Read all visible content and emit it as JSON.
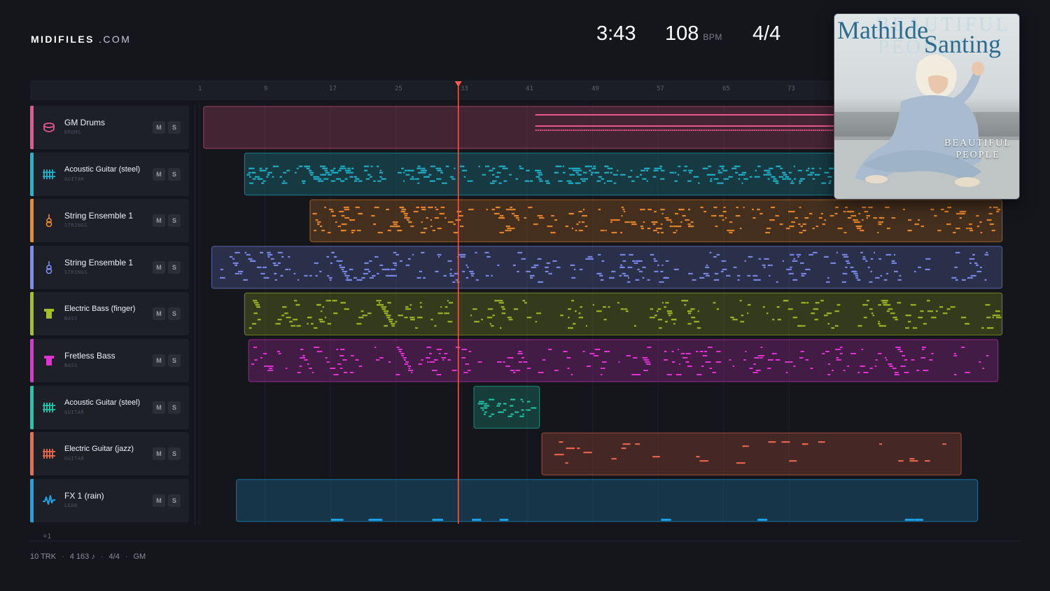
{
  "brand": {
    "name": "MIDIFILES",
    "suffix": ".COM"
  },
  "transport": {
    "time": "3:43",
    "tempo": "108",
    "tempo_unit": "BPM",
    "meter": "4/4"
  },
  "album": {
    "artist_first": "Mathilde",
    "artist_last": "Santing",
    "ghost_line1": "BEAUTIFUL",
    "ghost_line2": "PEOPLE",
    "title_line1": "BEAUTIFUL",
    "title_line2": "PEOPLE"
  },
  "ruler": {
    "bars": [
      "1",
      "9",
      "17",
      "25",
      "33",
      "41",
      "49",
      "57",
      "65",
      "73"
    ],
    "playhead_bar": 32.6
  },
  "mute_label": "M",
  "solo_label": "S",
  "tracks": [
    {
      "name": "GM Drums",
      "type": "DRUMS",
      "color": "#e8558a",
      "icon": "drum-icon",
      "clip_bars": [
        1.5,
        93
      ],
      "pattern": "drums"
    },
    {
      "name": "Acoustic Guitar (steel)",
      "type": "GUITAR",
      "color": "#1fb6cf",
      "icon": "guitar-fret-icon",
      "clip_bars": [
        6.5,
        93
      ],
      "pattern": "dense"
    },
    {
      "name": "String Ensemble 1",
      "type": "STRINGS",
      "color": "#ef8a2a",
      "icon": "violin-icon",
      "clip_bars": [
        14.5,
        99
      ],
      "pattern": "blocks"
    },
    {
      "name": "String Ensemble 1",
      "type": "STRINGS",
      "color": "#7d8cf2",
      "icon": "violin-icon",
      "clip_bars": [
        2.5,
        99
      ],
      "pattern": "runs"
    },
    {
      "name": "Electric Bass (finger)",
      "type": "BASS",
      "color": "#a3c123",
      "icon": "bass-icon",
      "clip_bars": [
        6.5,
        99
      ],
      "pattern": "sparse"
    },
    {
      "name": "Fretless Bass",
      "type": "BASS",
      "color": "#e331d6",
      "icon": "bass-icon",
      "clip_bars": [
        7,
        98.5
      ],
      "pattern": "sparse"
    },
    {
      "name": "Acoustic Guitar (steel)",
      "type": "GUITAR",
      "color": "#1ec9ac",
      "icon": "guitar-fret-icon",
      "clip_bars": [
        34.5,
        42.5
      ],
      "pattern": "dense"
    },
    {
      "name": "Electric Guitar (jazz)",
      "type": "GUITAR",
      "color": "#f06a4f",
      "icon": "guitar-fret-icon",
      "clip_bars": [
        42.8,
        94
      ],
      "pattern": "melody"
    },
    {
      "name": "FX 1 (rain)",
      "type": "LEAD",
      "color": "#1aa3e8",
      "icon": "wave-icon",
      "clip_bars": [
        5.5,
        96
      ],
      "pattern": "fx"
    }
  ],
  "more_tracks": "+1",
  "footer": {
    "tracks": "10 TRK",
    "notes": "4 163 ♪",
    "meter": "4/4",
    "standard": "GM"
  }
}
